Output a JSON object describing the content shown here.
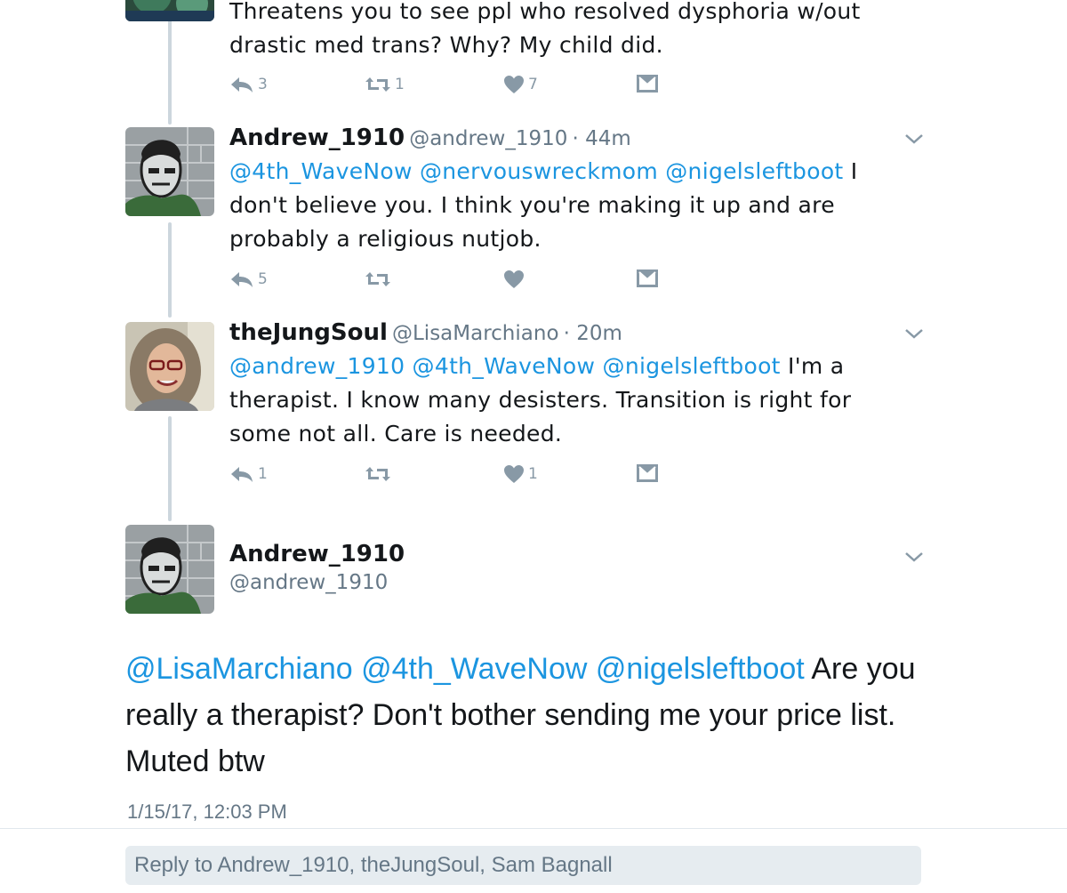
{
  "thread": [
    {
      "body_parts": [
        {
          "text": "Threatens you to see ppl who resolved dysphoria w/out drastic med trans? Why? My child did.",
          "mention": false
        }
      ],
      "counts": {
        "reply": "3",
        "retweet": "1",
        "like": "7"
      }
    },
    {
      "name": "Andrew_1910",
      "handle": "@andrew_1910",
      "time": "· 44m",
      "body_parts": [
        {
          "text": "@4th_WaveNow @nervouswreckmom @nigelsleftboot",
          "mention": true
        },
        {
          "text": " I don't believe you. I think you're making it up and are probably a religious nutjob.",
          "mention": false
        }
      ],
      "counts": {
        "reply": "5",
        "retweet": "",
        "like": ""
      }
    },
    {
      "name": "theJungSoul",
      "handle": "@LisaMarchiano",
      "time": "· 20m",
      "body_parts": [
        {
          "text": "@andrew_1910 @4th_WaveNow @nigelsleftboot",
          "mention": true
        },
        {
          "text": " I'm a therapist. I know many desisters. Transition is right for some not all. Care is needed.",
          "mention": false
        }
      ],
      "counts": {
        "reply": "1",
        "retweet": "",
        "like": "1"
      }
    }
  ],
  "focused": {
    "name": "Andrew_1910",
    "handle": "@andrew_1910",
    "mentions": "@LisaMarchiano @4th_WaveNow @nigelsleftboot",
    "text": " Are you really a therapist? Don't bother sending me your price list. Muted btw",
    "timestamp": "1/15/17, 12:03 PM"
  },
  "reply_placeholder": "Reply to Andrew_1910, theJungSoul, Sam Bagnall",
  "colors": {
    "mention": "#1b95e0",
    "icon_gray": "#8899a6",
    "thread_line": "#ccd6dd"
  },
  "icons": [
    "reply-icon",
    "retweet-icon",
    "like-icon",
    "direct-message-icon",
    "chevron-down-icon"
  ]
}
